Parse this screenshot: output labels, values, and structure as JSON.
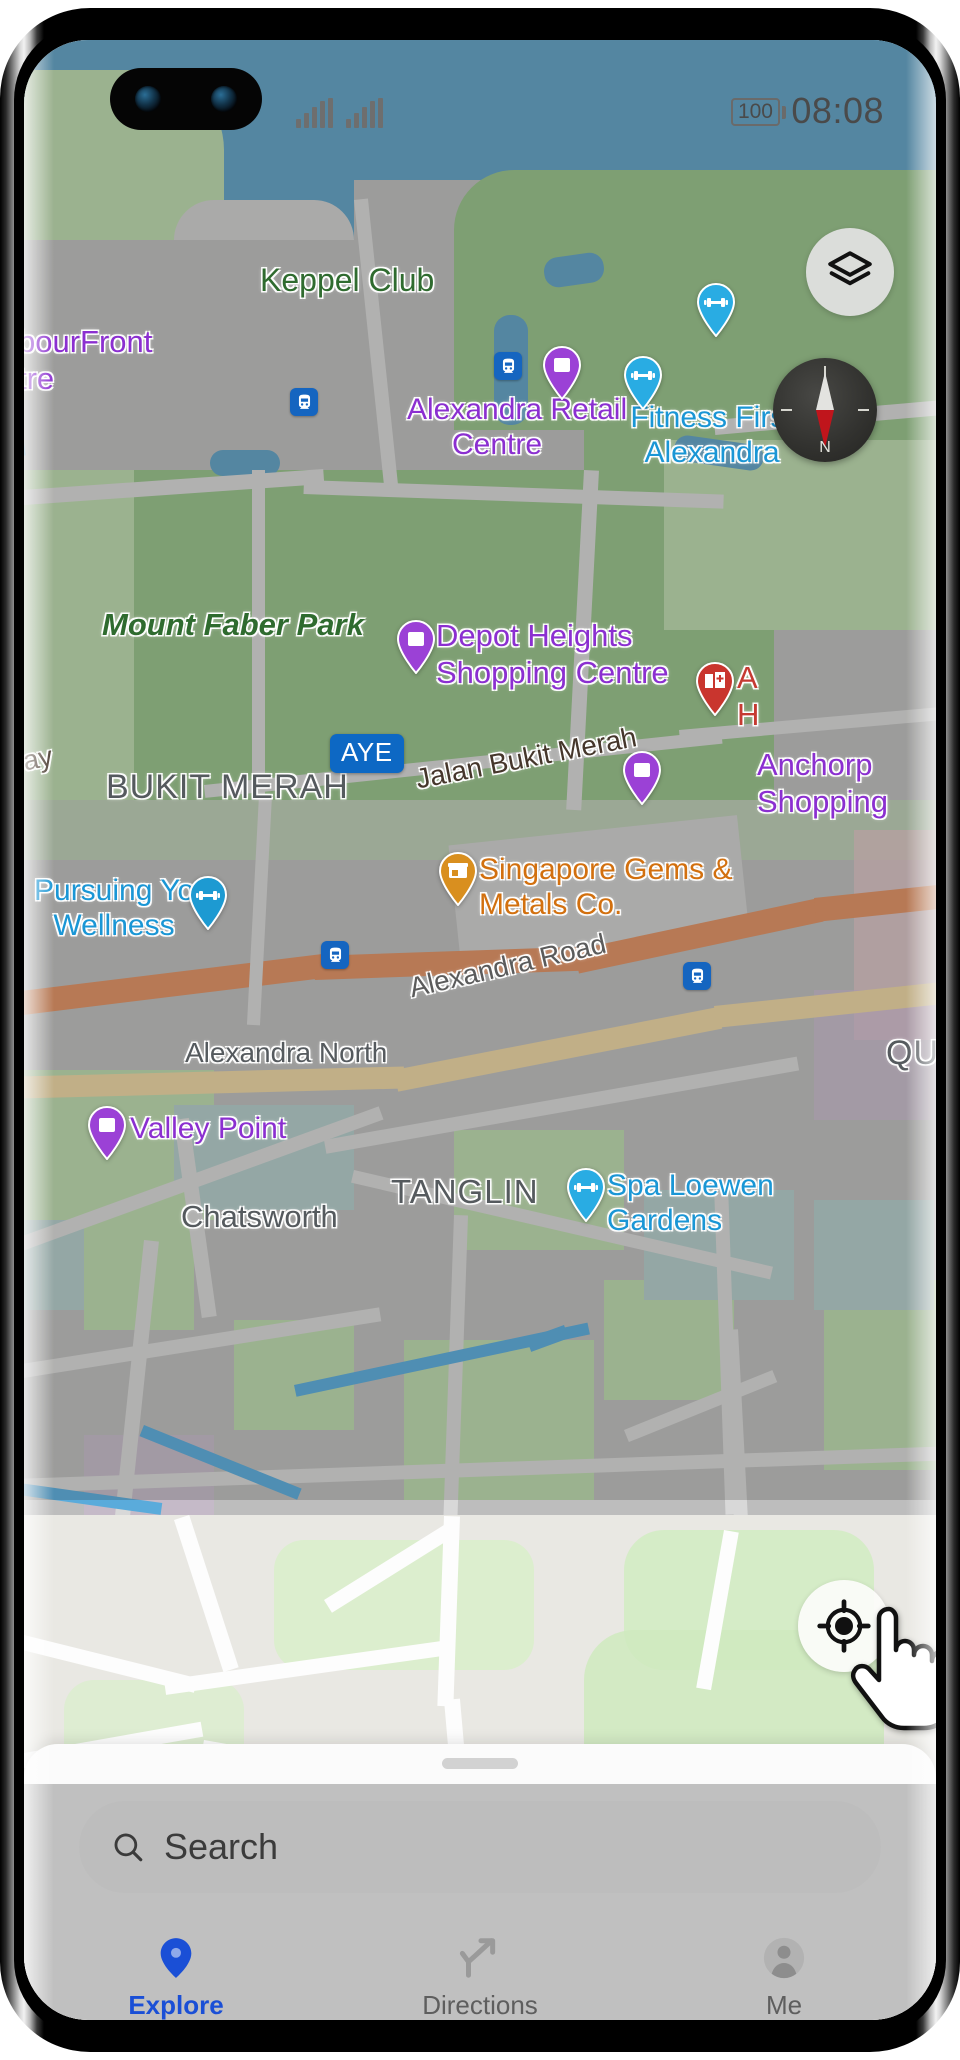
{
  "status_bar": {
    "battery_percent": "100",
    "time": "08:08",
    "signal_icon": "signal-bars-icon",
    "battery_icon": "battery-icon"
  },
  "map_controls": {
    "layers_button": {
      "icon": "layers-icon",
      "label": "Layers"
    },
    "compass": {
      "icon": "compass-icon",
      "north_letter": "N"
    },
    "locate_button": {
      "icon": "my-location-icon",
      "label": "My location"
    },
    "cursor": {
      "icon": "hand-pointer-cursor"
    }
  },
  "map_labels": [
    {
      "id": "keppel-club",
      "text": "Keppel Club",
      "kind": "park"
    },
    {
      "id": "harbourfront",
      "text": "bourFront\ntre",
      "kind": "shop"
    },
    {
      "id": "alexandra-retail",
      "text": "Alexandra Retail\nCentre",
      "kind": "shop"
    },
    {
      "id": "fitness-first",
      "text": "Fitness First\nAlexandra",
      "kind": "health"
    },
    {
      "id": "mount-faber-park",
      "text": "Mount Faber Park",
      "kind": "park"
    },
    {
      "id": "depot-heights",
      "text": "Depot Heights\nShopping Centre",
      "kind": "shop"
    },
    {
      "id": "alexandra-hospital",
      "text": "A\nH",
      "kind": "hospital"
    },
    {
      "id": "anchorpoint",
      "text": "Anchorp\nShopping",
      "kind": "shop"
    },
    {
      "id": "bukit-merah",
      "text": "BUKIT MERAH",
      "kind": "area"
    },
    {
      "id": "jalan-bukit-merah",
      "text": "Jalan Bukit Merah",
      "kind": "road"
    },
    {
      "id": "ayer-rajah-exp",
      "text": "ay",
      "kind": "road"
    },
    {
      "id": "pursuing-wellness",
      "text": "Pursuing Your\nWellness",
      "kind": "health"
    },
    {
      "id": "singapore-gems",
      "text": "Singapore Gems &\nMetals Co.",
      "kind": "store"
    },
    {
      "id": "alexandra-road",
      "text": "Alexandra Road",
      "kind": "road2"
    },
    {
      "id": "alexandra-north",
      "text": "Alexandra North",
      "kind": "area"
    },
    {
      "id": "queenstown",
      "text": "QUEE",
      "kind": "area"
    },
    {
      "id": "valley-point",
      "text": "Valley Point",
      "kind": "shop"
    },
    {
      "id": "tanglin",
      "text": "TANGLIN",
      "kind": "area"
    },
    {
      "id": "chatsworth",
      "text": "Chatsworth",
      "kind": "area"
    },
    {
      "id": "spa-loewen",
      "text": "Spa Loewen\nGardens",
      "kind": "health"
    }
  ],
  "highway_shield": {
    "text": "AYE",
    "color": "#0d68c4"
  },
  "pins": [
    {
      "id": "pin-alexandra-retail",
      "icon": "shopping-bag-pin",
      "color": "#9b41d6"
    },
    {
      "id": "pin-depot-heights",
      "icon": "shopping-bag-pin",
      "color": "#9b41d6"
    },
    {
      "id": "pin-anchorpoint",
      "icon": "shopping-bag-pin",
      "color": "#9b41d6"
    },
    {
      "id": "pin-valley-point",
      "icon": "shopping-bag-pin",
      "color": "#9b41d6"
    },
    {
      "id": "pin-fitness-first-1",
      "icon": "gym-dumbbell-pin",
      "color": "#29ace3"
    },
    {
      "id": "pin-fitness-first-2",
      "icon": "gym-dumbbell-pin",
      "color": "#29ace3"
    },
    {
      "id": "pin-pursuing-wellness",
      "icon": "gym-dumbbell-pin",
      "color": "#1d9ad2"
    },
    {
      "id": "pin-spa-loewen",
      "icon": "gym-dumbbell-pin",
      "color": "#29ace3"
    },
    {
      "id": "pin-singapore-gems",
      "icon": "store-front-pin",
      "color": "#d98f1f"
    },
    {
      "id": "pin-alexandra-hosp",
      "icon": "hospital-pin",
      "color": "#c9352e"
    }
  ],
  "transit_markers": [
    {
      "id": "transit-1",
      "icon": "train-icon"
    },
    {
      "id": "transit-2",
      "icon": "train-icon"
    },
    {
      "id": "transit-3",
      "icon": "train-icon"
    },
    {
      "id": "transit-4",
      "icon": "train-icon"
    }
  ],
  "sheet": {
    "handle": "drag-handle",
    "search": {
      "icon": "search-icon",
      "placeholder": "Search",
      "value": ""
    }
  },
  "bottom_nav": {
    "items": [
      {
        "id": "explore",
        "label": "Explore",
        "icon": "map-pin-icon",
        "active": true,
        "color": "#1a4fd6"
      },
      {
        "id": "directions",
        "label": "Directions",
        "icon": "directions-icon",
        "active": false,
        "color": "#8d8d8d"
      },
      {
        "id": "me",
        "label": "Me",
        "icon": "account-icon",
        "active": false,
        "color": "#8d8d8d"
      }
    ]
  },
  "colors": {
    "water": "#60a0c4",
    "park": "#96c08a",
    "land": "#bdbdbd",
    "motorway": "#df9063",
    "arterial": "#ecd5a3",
    "accent_blue": "#1a4fd6"
  }
}
